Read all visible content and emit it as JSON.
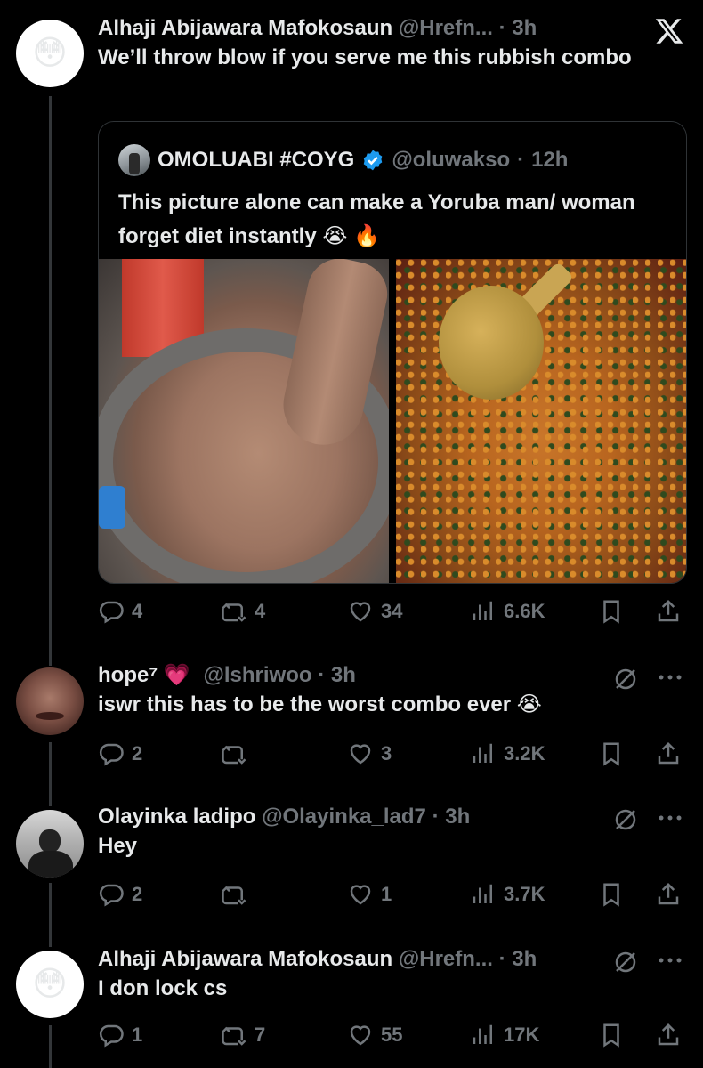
{
  "brand_colors": {
    "background": "#000000",
    "text": "#e7e9ea",
    "muted": "#71767b",
    "verified": "#1d9bf0",
    "thread_line": "#333639"
  },
  "posts": [
    {
      "name": "Alhaji Abijawara Mafokosaun",
      "handle": "@Hrefn...",
      "sep": "·",
      "time": "3h",
      "text": "We’ll throw blow if you serve me this rubbish combo",
      "avatar_icon": "astonished-face-emoji",
      "avatar_glyph": "😳",
      "stats": {
        "replies": "4",
        "reposts": "4",
        "likes": "34",
        "views": "6.6K"
      }
    },
    {
      "name": "hope⁷ 💗",
      "handle": "@lshriwoo",
      "sep": "·",
      "time": "3h",
      "text": "iswr this has to be the worst combo ever 😭",
      "stats": {
        "replies": "2",
        "reposts": "",
        "likes": "3",
        "views": "3.2K"
      }
    },
    {
      "name": "Olayinka ladipo",
      "handle": "@Olayinka_lad7",
      "sep": "·",
      "time": "3h",
      "text": "Hey",
      "stats": {
        "replies": "2",
        "reposts": "",
        "likes": "1",
        "views": "3.7K"
      }
    },
    {
      "name": "Alhaji Abijawara Mafokosaun",
      "handle": "@Hrefn...",
      "sep": "·",
      "time": "3h",
      "text": "I don lock cs",
      "avatar_glyph": "😳",
      "stats": {
        "replies": "1",
        "reposts": "7",
        "likes": "55",
        "views": "17K"
      }
    }
  ],
  "quote": {
    "name": "OMOLUABI #COYG",
    "handle": "@oluwakso",
    "sep": "·",
    "time": "12h",
    "verified": true,
    "text": "This picture alone can make a Yoruba man/ woman forget diet instantly 😭 🔥",
    "images": [
      "amala-dough-in-bowl-photo",
      "ewedu-egusi-soup-with-ladle-photo"
    ]
  },
  "icons": {
    "logo": "x-logo-icon",
    "reply": "reply-bubble-icon",
    "repost": "repost-arrows-icon",
    "like": "heart-icon",
    "views": "views-bar-chart-icon",
    "bookmark": "bookmark-icon",
    "share": "share-upload-icon",
    "grok": "grok-slash-circle-icon",
    "more": "more-dots-icon"
  }
}
